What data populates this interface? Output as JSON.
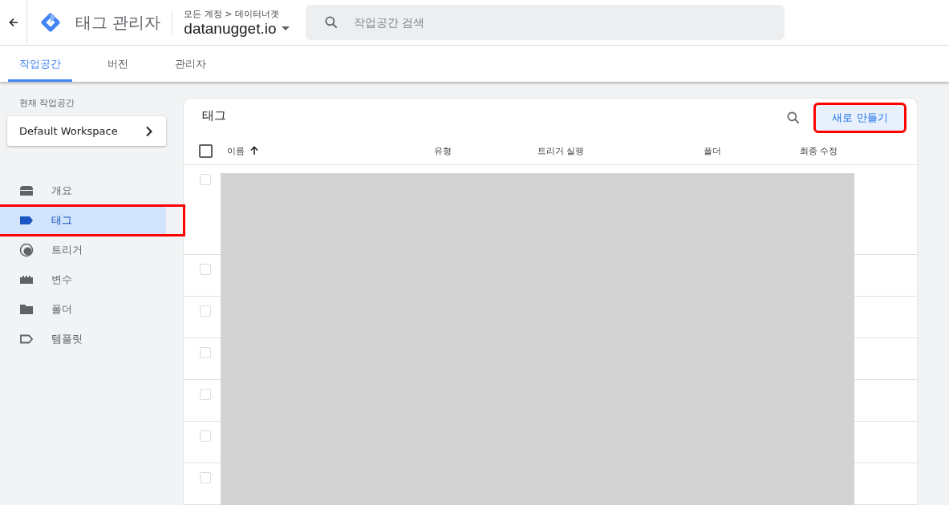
{
  "header": {
    "app_title": "태그 관리자",
    "breadcrumb": "모든 계정 > 데이터너겟",
    "container": "datanugget.io",
    "search": {
      "placeholder": "작업공간 검색"
    }
  },
  "tabs": [
    {
      "label": "작업공간",
      "selected": true
    },
    {
      "label": "버전",
      "selected": false
    },
    {
      "label": "관리자",
      "selected": false
    }
  ],
  "sidebar": {
    "workspace_label": "현재 작업공간",
    "workspace": "Default Workspace",
    "items": [
      {
        "label": "개요",
        "kind": "overview",
        "selected": false,
        "highlighted": false
      },
      {
        "label": "태그",
        "kind": "tag",
        "selected": true,
        "highlighted": true
      },
      {
        "label": "트리거",
        "kind": "trigger",
        "selected": false,
        "highlighted": false
      },
      {
        "label": "변수",
        "kind": "variable",
        "selected": false,
        "highlighted": false
      },
      {
        "label": "폴더",
        "kind": "folder",
        "selected": false,
        "highlighted": false
      },
      {
        "label": "템플릿",
        "kind": "template",
        "selected": false,
        "highlighted": false
      }
    ]
  },
  "table": {
    "title": "태그",
    "new_button": {
      "label": "새로 만들기",
      "highlighted": true
    },
    "select_all_checked": false,
    "columns": [
      "이름",
      "유형",
      "트리거 실행",
      "폴더",
      "최종 수정"
    ],
    "rows": [
      {
        "checked": false,
        "tall": true
      },
      {
        "checked": false,
        "tall": false
      },
      {
        "checked": false,
        "tall": false
      },
      {
        "checked": false,
        "tall": false
      },
      {
        "checked": false,
        "tall": false
      },
      {
        "checked": false,
        "tall": false
      },
      {
        "checked": false,
        "tall": false
      }
    ],
    "redacted": true
  }
}
